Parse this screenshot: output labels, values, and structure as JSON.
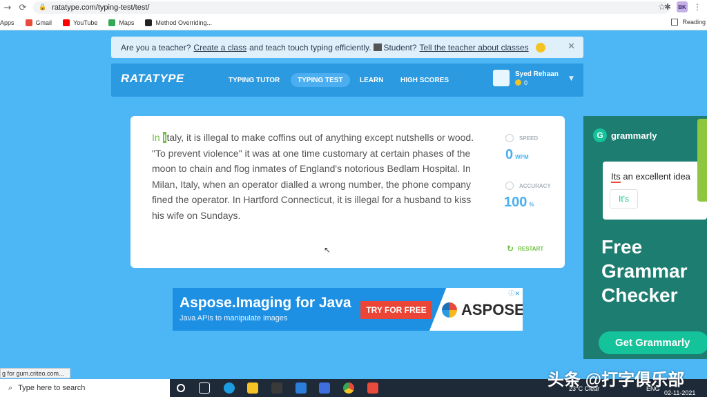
{
  "browser": {
    "url": "ratatype.com/typing-test/test/",
    "bookmarks": [
      "Apps",
      "Gmail",
      "YouTube",
      "Maps",
      "Method Overriding..."
    ],
    "reading_list": "Reading",
    "profile_initials": "BK"
  },
  "notice": {
    "text_start": "Are you a teacher?",
    "link1": "Create a class",
    "text_mid": "and teach touch typing efficiently.",
    "text_student": "Student?",
    "link2": "Tell the teacher about classes"
  },
  "navbar": {
    "logo": "RATATYPE",
    "items": [
      "TYPING TUTOR",
      "TYPING TEST",
      "LEARN",
      "HIGH SCORES"
    ],
    "active": "TYPING TEST",
    "user_name": "Syed Rehaan",
    "user_coins": "0"
  },
  "test": {
    "typed": "In ",
    "current_char": "I",
    "remaining": "taly, it is illegal to make coffins out of anything except nutshells or wood. \"To prevent violence\" it was at one time customary at certain phases of the moon to chain and flog inmates of England's notorious Bedlam Hospital. In Milan, Italy, when an operator dialled a wrong number, the phone company fined the operator. In Hartford Connecticut, it is illegal for a husband to kiss his wife on Sundays.",
    "speed_label": "SPEED",
    "speed_value": "0",
    "speed_unit": "WPM",
    "accuracy_label": "ACCURACY",
    "accuracy_value": "100",
    "accuracy_unit": "%",
    "restart_label": "RESTART"
  },
  "ad_aspose": {
    "title": "Aspose.Imaging for Java",
    "subtitle": "Java APIs to manipulate images",
    "button": "TRY FOR FREE",
    "brand": "ASPOSE"
  },
  "ad_grammarly": {
    "brand": "grammarly",
    "sample_bad": "Its",
    "sample_rest": " an excellent idea",
    "suggestion": "It's",
    "headline": [
      "Free",
      "Grammar",
      "Checker"
    ],
    "button": "Get Grammarly"
  },
  "status_tip": "g for gum.criteo.com...",
  "taskbar": {
    "search_placeholder": "Type here to search",
    "weather": "23°C  Clear",
    "lang": "ENG",
    "date": "02-11-2021"
  },
  "watermark": "头条 @打字俱乐部"
}
